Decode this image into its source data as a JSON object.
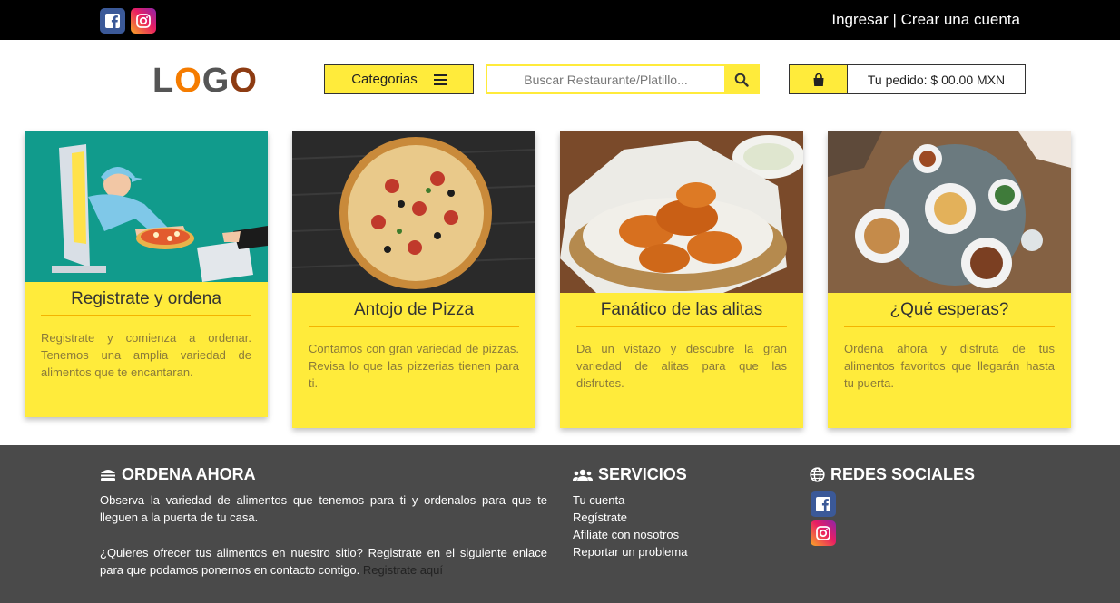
{
  "topbar": {
    "login": "Ingresar",
    "separator": "|",
    "signup": "Crear una cuenta"
  },
  "header": {
    "logo_letters": [
      "L",
      "O",
      "G",
      "O"
    ],
    "categories_label": "Categorias",
    "search_placeholder": "Buscar Restaurante/Platillo...",
    "order_label": "Tu pedido: $ 00.00 MXN"
  },
  "cards": [
    {
      "title": "Registrate y ordena",
      "text": "Registrate y comienza a ordenar. Tenemos una amplia variedad de alimentos que te encantaran."
    },
    {
      "title": "Antojo de Pizza",
      "text": "Contamos con gran variedad de pizzas. Revisa lo que las pizzerias tienen para ti."
    },
    {
      "title": "Fanático de las alitas",
      "text": "Da un vistazo y descubre la gran variedad de alitas para que las disfrutes."
    },
    {
      "title": "¿Qué esperas?",
      "text": "Ordena ahora y disfruta de tus alimentos favoritos que llegarán hasta tu puerta."
    }
  ],
  "footer": {
    "col1_title": "ORDENA AHORA",
    "col1_p1": "Observa la variedad de alimentos que tenemos para ti y ordenalos para que te lleguen a la puerta de tu casa.",
    "col1_p2": "¿Quieres ofrecer tus alimentos en nuestro sitio? Registrate en el siguiente enlace para que podamos ponernos en contacto contigo.",
    "col1_link": "Registrate aquí",
    "col2_title": "SERVICIOS",
    "col2_links": [
      "Tu cuenta",
      "Regístrate",
      "Afiliate con nosotros",
      "Reportar un problema"
    ],
    "col3_title": "REDES SOCIALES"
  },
  "colors": {
    "accent": "#ffeb3b",
    "card_rule": "#f5b300",
    "topbar": "#000000",
    "footer": "#4a4a4a"
  },
  "icons": {
    "social": [
      "facebook-icon",
      "instagram-icon"
    ],
    "header": [
      "menu-icon",
      "search-icon",
      "shopping-bag-icon"
    ],
    "footer": [
      "burger-icon",
      "users-icon",
      "globe-icon"
    ]
  }
}
